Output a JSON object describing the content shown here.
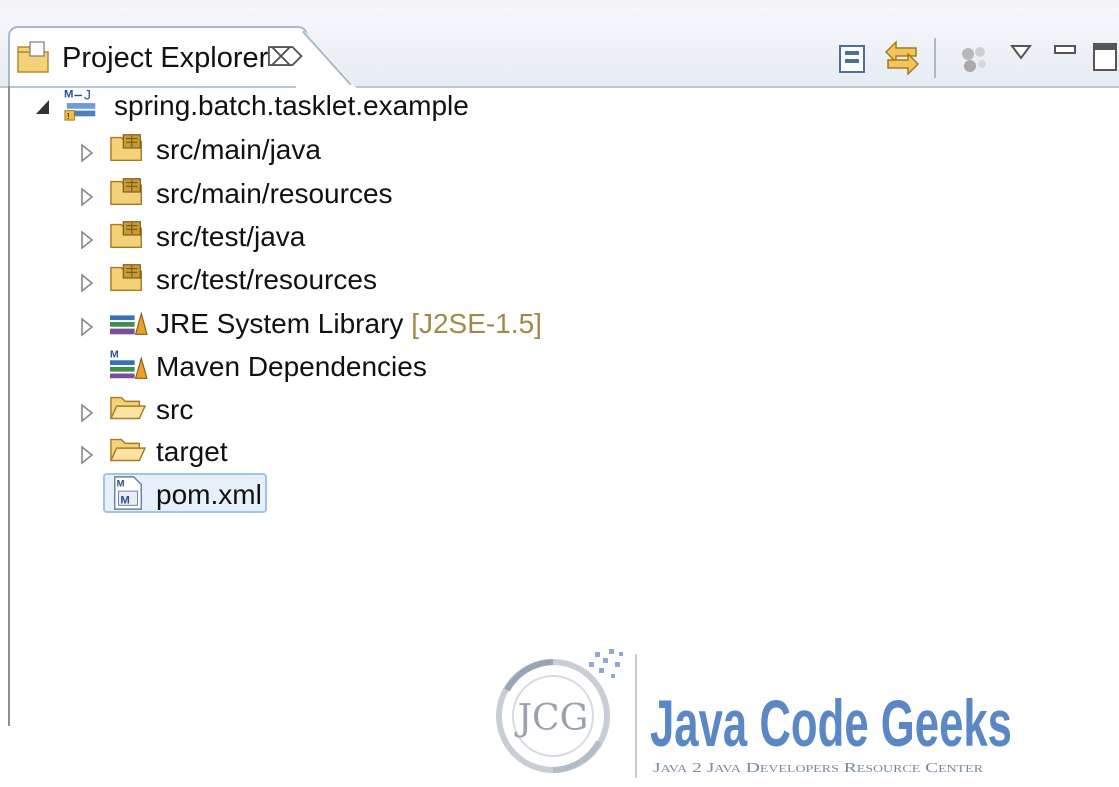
{
  "view": {
    "title": "Project Explorer",
    "close_glyph": "⌦"
  },
  "toolbar": {
    "items": [
      {
        "name": "collapse-all-icon"
      },
      {
        "name": "link-with-editor-icon"
      },
      {
        "name": "filters-icon"
      },
      {
        "name": "view-menu-icon"
      },
      {
        "name": "minimize-icon"
      },
      {
        "name": "maximize-icon"
      }
    ]
  },
  "tree": {
    "project": "spring.batch.tasklet.example",
    "items": [
      {
        "label": "src/main/java",
        "icon": "source-folder-icon",
        "expandable": true
      },
      {
        "label": "src/main/resources",
        "icon": "source-folder-icon",
        "expandable": true
      },
      {
        "label": "src/test/java",
        "icon": "source-folder-icon",
        "expandable": true
      },
      {
        "label": "src/test/resources",
        "icon": "source-folder-icon",
        "expandable": true
      },
      {
        "label": "JRE System Library",
        "decoration": "[J2SE-1.5]",
        "icon": "library-icon",
        "expandable": true
      },
      {
        "label": "Maven Dependencies",
        "icon": "maven-library-icon",
        "expandable": false
      },
      {
        "label": "src",
        "icon": "folder-icon",
        "expandable": true
      },
      {
        "label": "target",
        "icon": "folder-icon",
        "expandable": true
      },
      {
        "label": "pom.xml",
        "icon": "maven-pom-icon",
        "expandable": false,
        "selected": true
      }
    ]
  },
  "watermark": {
    "monogram": "JCG",
    "brand": "Java Code Geeks",
    "tagline": "Java 2 Java Developers Resource Center"
  },
  "colors": {
    "accent": "#5b87c4",
    "selection": "#e6f0fb",
    "decoration": "#a08a4a"
  }
}
